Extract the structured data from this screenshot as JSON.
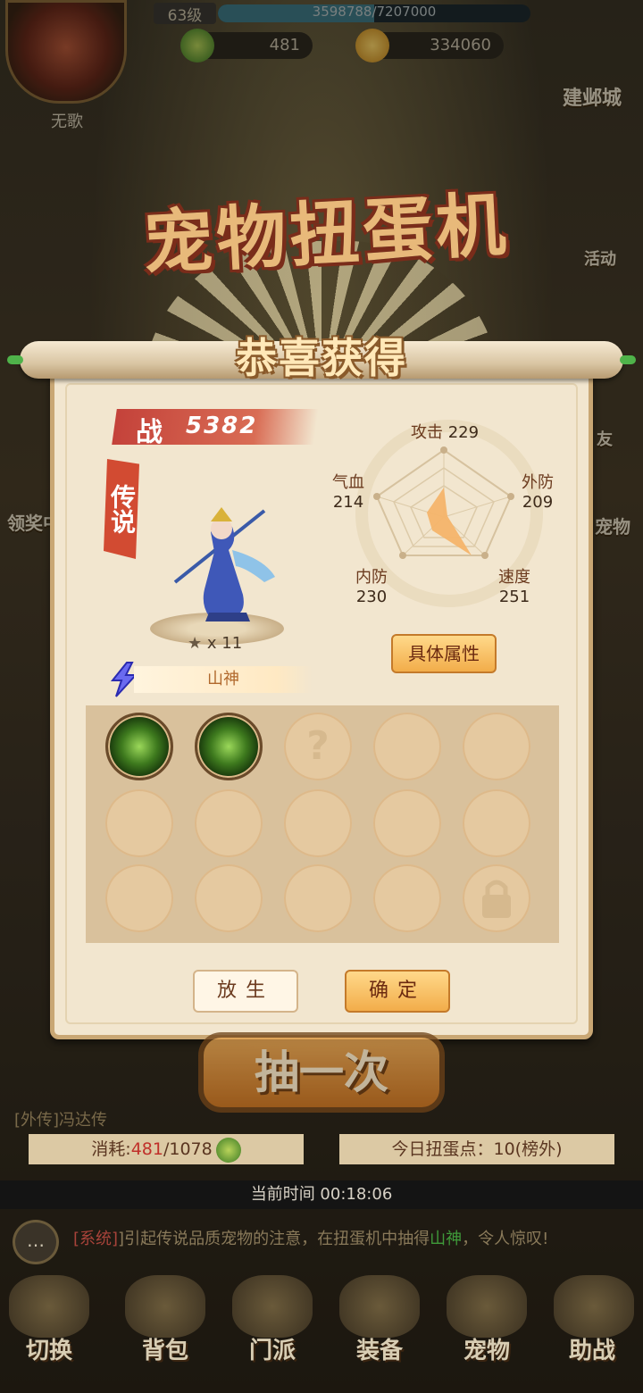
{
  "hud": {
    "player_name": "无歌",
    "level": "63级",
    "exp_text": "3598788/7207000",
    "exp_fraction": 0.499,
    "currency_1": "481",
    "currency_2": "334060"
  },
  "side_buttons": {
    "top_right": "建邺城",
    "activity": "活动",
    "friends": "友",
    "pet": "宠物",
    "reward": "领奖中"
  },
  "title": "宠物扭蛋机",
  "dialog": {
    "banner": "恭喜获得",
    "power_label": "战",
    "power_value": "5382",
    "rarity": "传说",
    "star_count": "x 11",
    "pet_name": "山神",
    "stats": {
      "attack_label": "攻击",
      "attack": "229",
      "hp_label": "气血",
      "hp": "214",
      "outer_def_label": "外防",
      "outer_def": "209",
      "inner_def_label": "内防",
      "inner_def": "230",
      "speed_label": "速度",
      "speed": "251"
    },
    "detail_button": "具体属性",
    "release_button": "放生",
    "confirm_button": "确定",
    "skill_slot_unknown": "?"
  },
  "draw_button": "抽一次",
  "outer_story": "[外传]冯达传",
  "cost": {
    "label": "消耗:",
    "current": "481",
    "total": "/1078"
  },
  "gacha_points": "今日扭蛋点：10(榜外)",
  "current_time": "当前时间 00:18:06",
  "system_message": {
    "tag": "[系统]",
    "text_1": "]引起传说品质宠物的注意，在扭蛋机中抽得",
    "highlight": "山神",
    "text_2": "，令人惊叹!"
  },
  "nav": [
    "切换",
    "背包",
    "门派",
    "装备",
    "宠物",
    "助战"
  ]
}
